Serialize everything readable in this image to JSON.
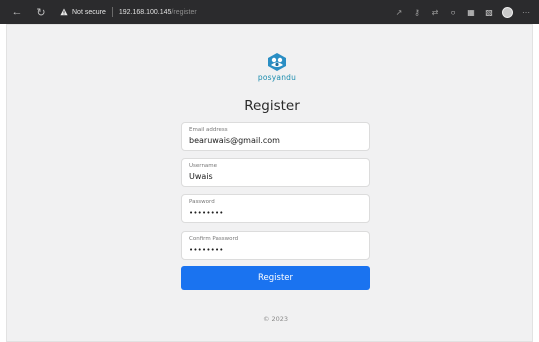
{
  "browser": {
    "security_label": "Not secure",
    "url_host": "192.168.100.145",
    "url_path": "/register"
  },
  "logo": {
    "brand_text": "posyandu"
  },
  "page": {
    "title": "Register"
  },
  "form": {
    "email": {
      "label": "Email address",
      "value": "bearuwais@gmail.com"
    },
    "username": {
      "label": "Username",
      "value": "Uwais"
    },
    "password": {
      "label": "Password",
      "value": "••••••••"
    },
    "confirm_password": {
      "label": "Confirm Password",
      "value": "••••••••"
    },
    "submit_label": "Register"
  },
  "footer": {
    "text": "© 2023"
  },
  "colors": {
    "primary": "#1a73f0",
    "brand": "#1b8cae"
  }
}
